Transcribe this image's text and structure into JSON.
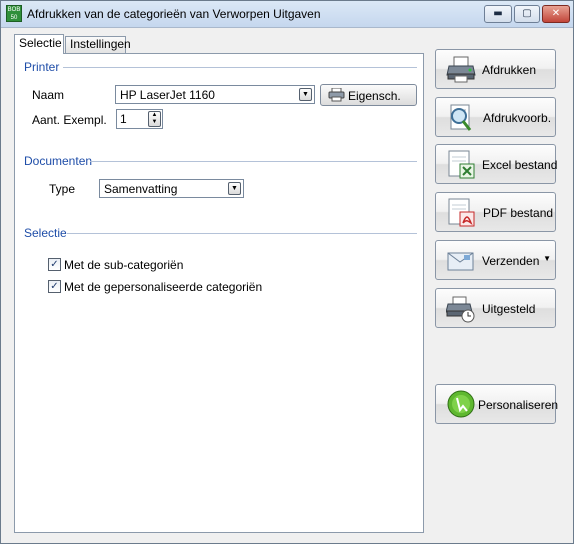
{
  "window": {
    "title": "Afdrukken van de categorieën van Verworpen Uitgaven",
    "app_icon_text": "BOB 50",
    "controls": {
      "minimize": "▬",
      "maximize": "▢",
      "close": "✕"
    }
  },
  "tabs": [
    {
      "label": "Selectie",
      "active": true
    },
    {
      "label": "Instellingen",
      "active": false
    }
  ],
  "printer": {
    "section_title": "Printer",
    "name_label": "Naam",
    "name_value": "HP LaserJet 1160",
    "properties_button": "Eigensch.",
    "copies_label": "Aant. Exempl.",
    "copies_value": "1"
  },
  "documents": {
    "section_title": "Documenten",
    "type_label": "Type",
    "type_value": "Samenvatting"
  },
  "selection": {
    "section_title": "Selectie",
    "options": [
      {
        "label": "Met de sub-categoriën",
        "checked": true
      },
      {
        "label": "Met de gepersonaliseerde categoriën",
        "checked": true
      }
    ]
  },
  "actions": {
    "print": "Afdrukken",
    "preview": "Afdrukvoorb.",
    "excel": "Excel bestand",
    "pdf": "PDF bestand",
    "send": "Verzenden",
    "deferred": "Uitgesteld",
    "personalize": "Personaliseren"
  }
}
